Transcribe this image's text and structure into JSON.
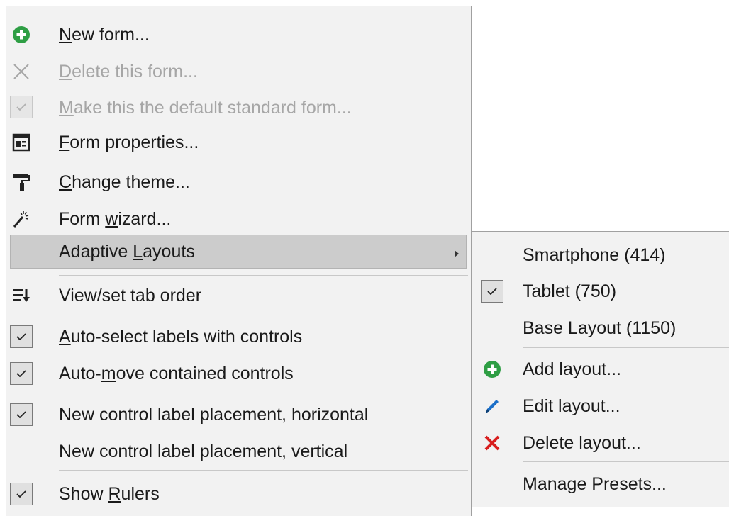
{
  "main_menu": {
    "items": [
      {
        "pre": "",
        "u": "N",
        "post": "ew form..."
      },
      {
        "pre": "",
        "u": "D",
        "post": "elete this form..."
      },
      {
        "pre": "",
        "u": "M",
        "post": "ake this the default standard form..."
      },
      {
        "pre": "",
        "u": "F",
        "post": "orm properties..."
      },
      {
        "pre": "",
        "u": "C",
        "post": "hange theme..."
      },
      {
        "pre": "Form ",
        "u": "w",
        "post": "izard..."
      },
      {
        "pre": "Adaptive ",
        "u": "L",
        "post": "ayouts"
      },
      {
        "pre": "View/set tab order",
        "u": "",
        "post": ""
      },
      {
        "pre": "",
        "u": "A",
        "post": "uto-select labels with controls"
      },
      {
        "pre": "Auto-",
        "u": "m",
        "post": "ove contained controls"
      },
      {
        "pre": "New control label placement, horizontal",
        "u": "",
        "post": ""
      },
      {
        "pre": "New control label placement, vertical",
        "u": "",
        "post": ""
      },
      {
        "pre": "Show ",
        "u": "R",
        "post": "ulers"
      }
    ]
  },
  "sub_menu": {
    "items": [
      {
        "label": "Smartphone (414)"
      },
      {
        "label": "Tablet (750)"
      },
      {
        "label": "Base Layout (1150)"
      },
      {
        "label": "Add layout..."
      },
      {
        "label": "Edit layout..."
      },
      {
        "label": "Delete layout..."
      },
      {
        "label": "Manage Presets..."
      }
    ]
  },
  "colors": {
    "green": "#2e9e44",
    "red": "#d81e1e",
    "blue": "#1b6fc8"
  },
  "icons": {
    "new_form": "plus-circle-icon",
    "delete_form": "x-icon",
    "default_form": "check-icon",
    "form_properties": "form-properties-icon",
    "change_theme": "paint-roller-icon",
    "form_wizard": "magic-wand-icon",
    "tab_order": "tab-order-icon",
    "add_layout": "plus-circle-icon",
    "edit_layout": "pencil-icon",
    "delete_layout": "x-icon"
  }
}
